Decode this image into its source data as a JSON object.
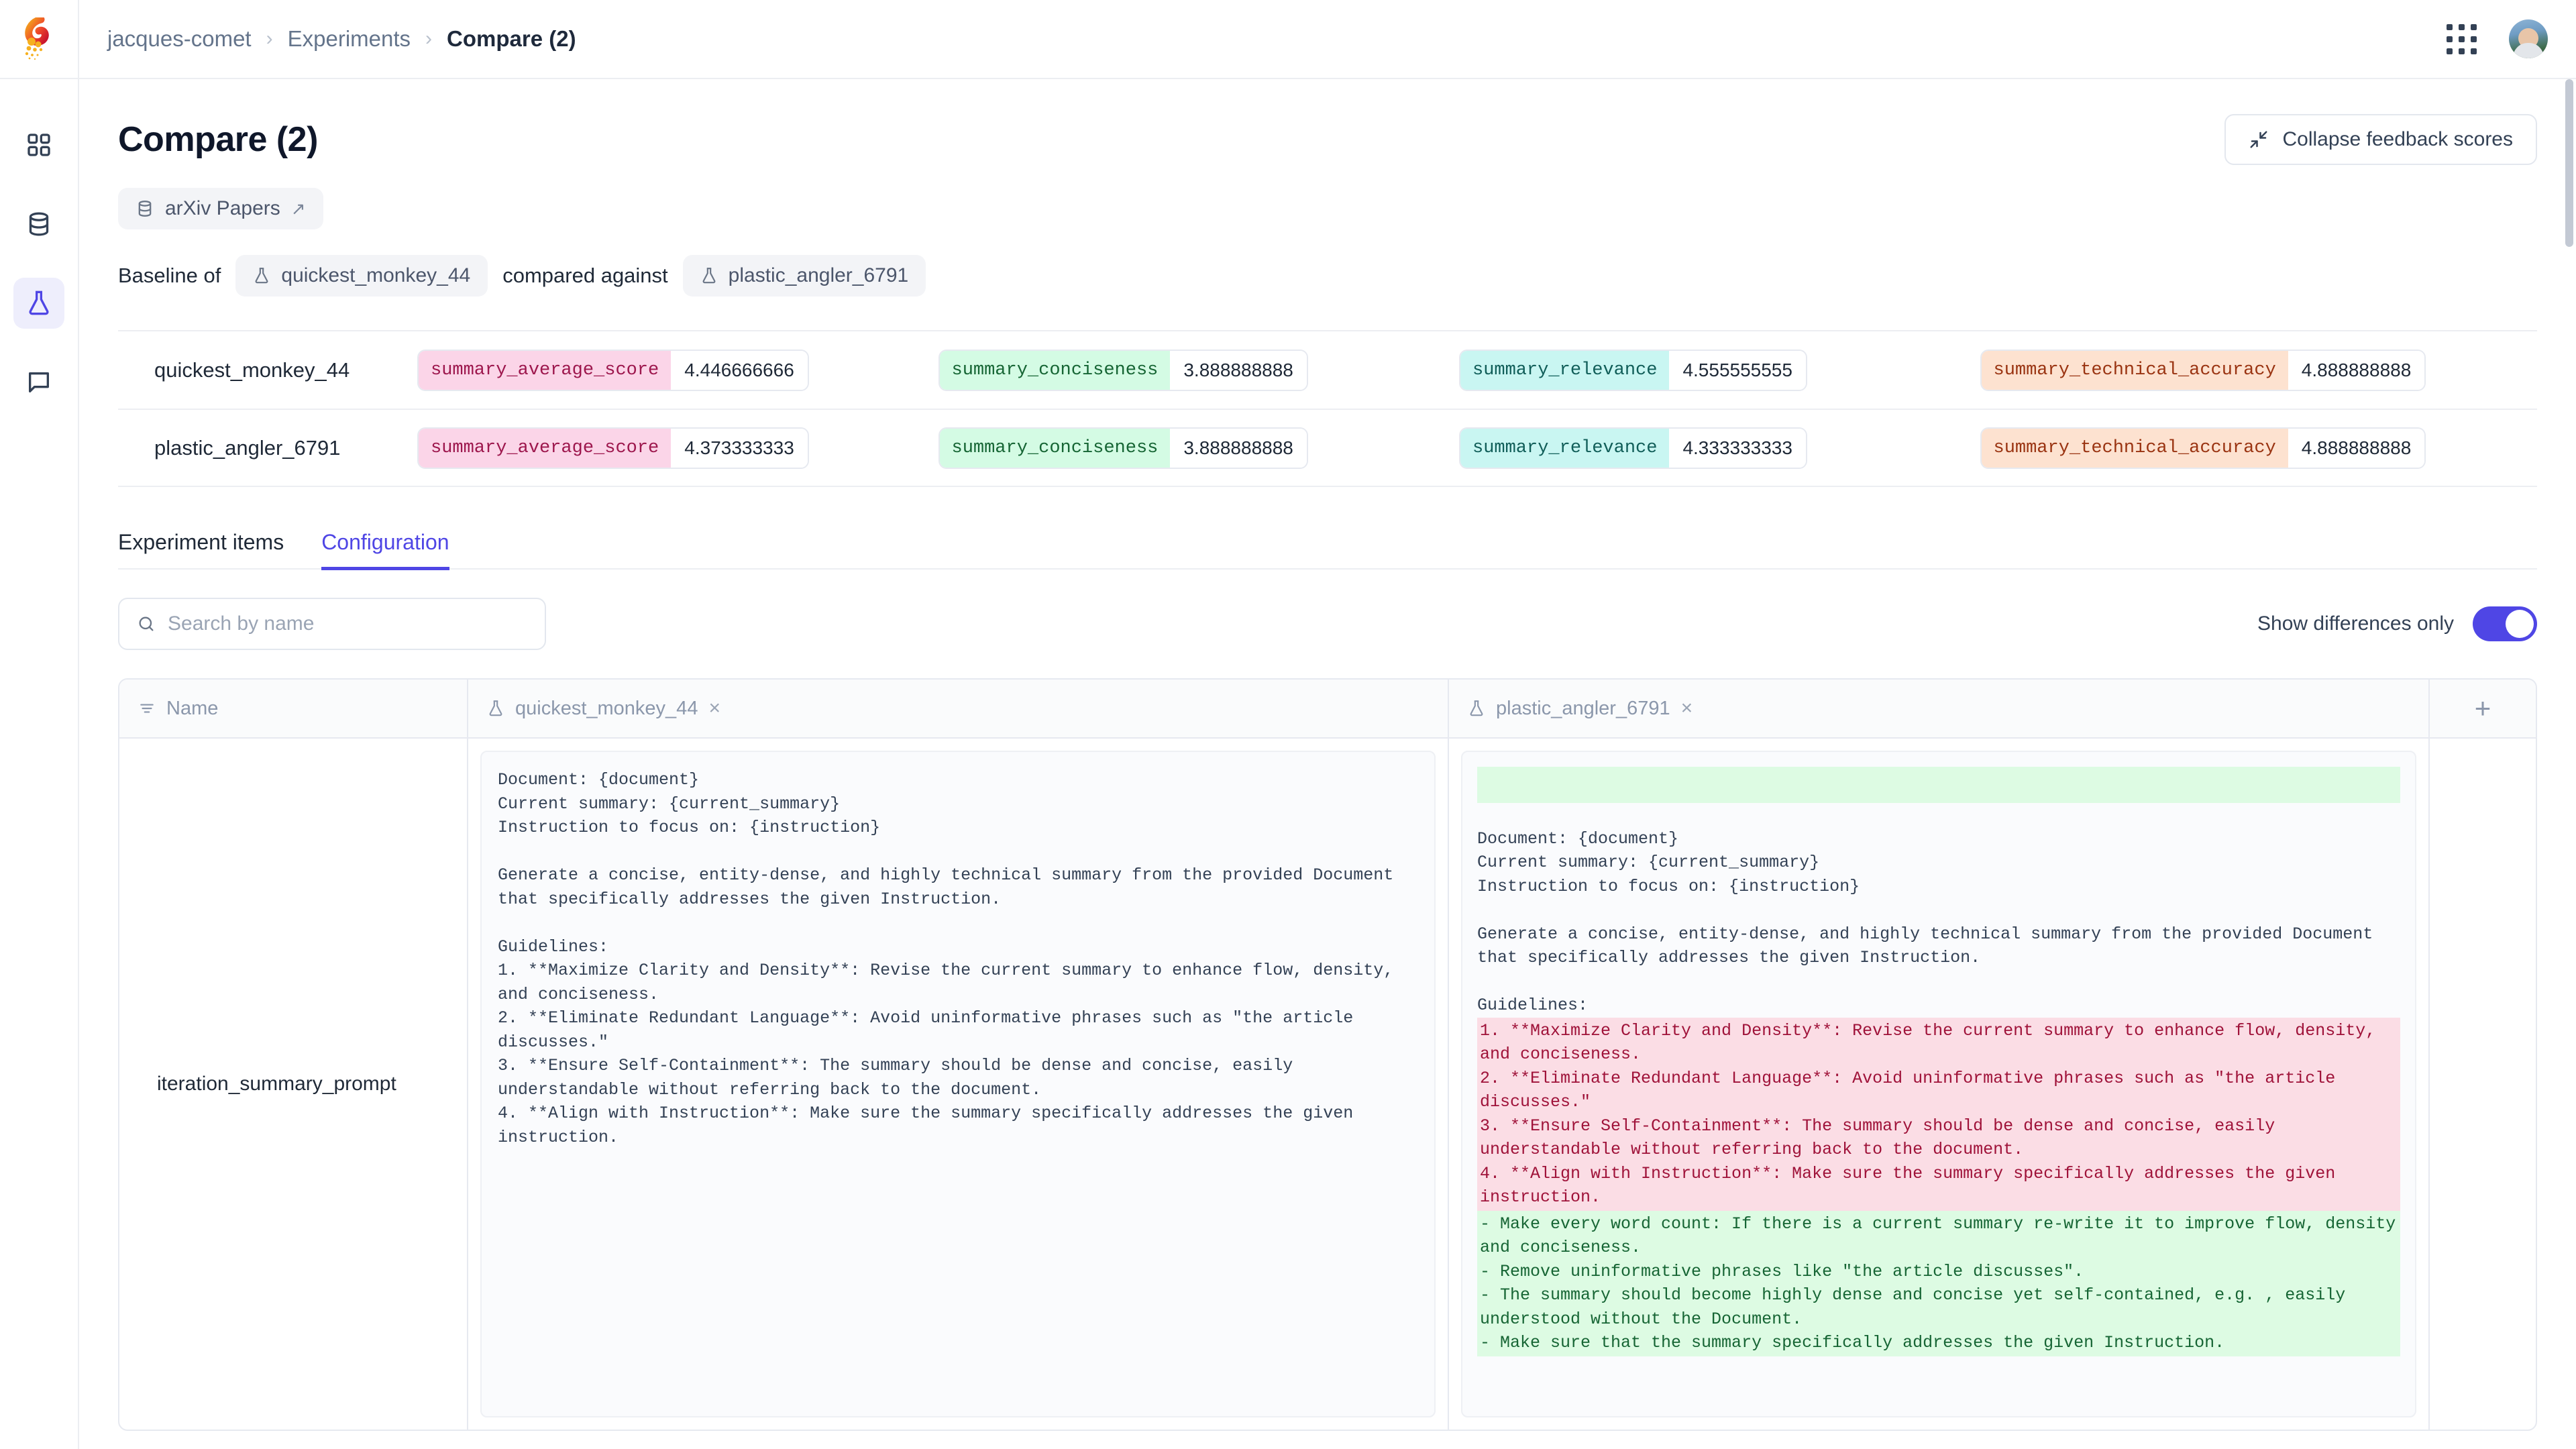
{
  "brand": {
    "logo_name": "comet-logo"
  },
  "breadcrumb": {
    "workspace": "jacques-comet",
    "section": "Experiments",
    "current": "Compare (2)",
    "separator": "›"
  },
  "sidebar": {
    "items": [
      {
        "icon": "grid-dashboard-icon",
        "name": "home",
        "active": false
      },
      {
        "icon": "database-icon",
        "name": "datasets",
        "active": false
      },
      {
        "icon": "flask-icon",
        "name": "experiments",
        "active": true
      },
      {
        "icon": "chat-bubble-icon",
        "name": "feedback",
        "active": false
      }
    ]
  },
  "header": {
    "title": "Compare (2)",
    "collapse_button": "Collapse feedback scores",
    "collapse_icon": "collapse-arrows-icon",
    "apps_icon": "apps-grid-icon",
    "avatar_icon": "user-avatar"
  },
  "dataset_chip": {
    "label": "arXiv Papers",
    "icon": "database-icon",
    "external_icon": "↗"
  },
  "baseline": {
    "prefix": "Baseline of",
    "baseline_experiment": "quickest_monkey_44",
    "middle": "compared against",
    "compared_experiment": "plastic_angler_6791",
    "flask_icon": "flask-icon"
  },
  "score_colors": {
    "summary_average_score_bg": "#fbd5e8",
    "summary_average_score_fg": "#9d174d",
    "summary_conciseness_bg": "#d4fbe4",
    "summary_conciseness_fg": "#166534",
    "summary_relevance_bg": "#c9f6f2",
    "summary_technical_accuracy_bg": "#fde2d0",
    "summary_technical_accuracy_fg": "#9a3412",
    "summary_relevance_fg": "#115e59"
  },
  "scores": {
    "rows": [
      {
        "name": "quickest_monkey_44",
        "cells": [
          {
            "key": "summary_average_score",
            "value": "4.446666666"
          },
          {
            "key": "summary_conciseness",
            "value": "3.888888888"
          },
          {
            "key": "summary_relevance",
            "value": "4.555555555"
          },
          {
            "key": "summary_technical_accuracy",
            "value": "4.888888888"
          }
        ]
      },
      {
        "name": "plastic_angler_6791",
        "cells": [
          {
            "key": "summary_average_score",
            "value": "4.373333333"
          },
          {
            "key": "summary_conciseness",
            "value": "3.888888888"
          },
          {
            "key": "summary_relevance",
            "value": "4.333333333"
          },
          {
            "key": "summary_technical_accuracy",
            "value": "4.888888888"
          }
        ]
      }
    ]
  },
  "tabs": [
    {
      "label": "Experiment items",
      "active": false
    },
    {
      "label": "Configuration",
      "active": true
    }
  ],
  "toolbar": {
    "search_placeholder": "Search by name",
    "search_value": "",
    "search_icon": "search-icon",
    "toggle_label": "Show differences only",
    "toggle_on": true,
    "toggle_color": "#4f46e5"
  },
  "diff_table": {
    "columns": {
      "name_header": "Name",
      "name_icon": "sort-lines-icon",
      "col1": "quickest_monkey_44",
      "col2": "plastic_angler_6791",
      "close_icon": "×",
      "add_icon": "+"
    },
    "row": {
      "name": "iteration_summary_prompt",
      "left_text": "Document: {document}\nCurrent summary: {current_summary}\nInstruction to focus on: {instruction}\n\nGenerate a concise, entity-dense, and highly technical summary from the provided Document that specifically addresses the given Instruction.\n\nGuidelines:\n1. **Maximize Clarity and Density**: Revise the current summary to enhance flow, density, and conciseness.\n2. **Eliminate Redundant Language**: Avoid uninformative phrases such as \"the article discusses.\"\n3. **Ensure Self-Containment**: The summary should be dense and concise, easily understandable without referring back to the document.\n4. **Align with Instruction**: Make sure the summary specifically addresses the given instruction.",
      "right_segments": [
        {
          "type": "blank-add",
          "text": ""
        },
        {
          "type": "same",
          "text": "\nDocument: {document}\nCurrent summary: {current_summary}\nInstruction to focus on: {instruction}\n\nGenerate a concise, entity-dense, and highly technical summary from the provided Document that specifically addresses the given Instruction.\n\nGuidelines:\n"
        },
        {
          "type": "del",
          "text": "1. **Maximize Clarity and Density**: Revise the current summary to enhance flow, density, and conciseness.\n2. **Eliminate Redundant Language**: Avoid uninformative phrases such as \"the article discusses.\"\n3. **Ensure Self-Containment**: The summary should be dense and concise, easily understandable without referring back to the document.\n4. **Align with Instruction**: Make sure the summary specifically addresses the given instruction."
        },
        {
          "type": "add",
          "text": "- Make every word count: If there is a current summary re-write it to improve flow, density and conciseness.\n- Remove uninformative phrases like \"the article discusses\".\n- The summary should become highly dense and concise yet self-contained, e.g. , easily understood without the Document.\n- Make sure that the summary specifically addresses the given Instruction."
        }
      ]
    }
  }
}
